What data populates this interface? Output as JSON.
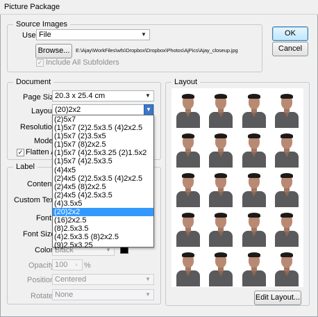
{
  "window": {
    "title": "Picture Package"
  },
  "source": {
    "legend": "Source Images",
    "use_label": "Use:",
    "use_value": "File",
    "browse_label": "Browse...",
    "file_path": "E:\\Ajay\\WorkFiles\\wfs\\Dropbox\\Dropbox\\Photos\\AjPics\\Ajay_closeup.jpg",
    "include_subfolders": "Include All Subfolders"
  },
  "buttons": {
    "ok": "OK",
    "cancel": "Cancel",
    "edit_layout": "Edit Layout..."
  },
  "document": {
    "legend": "Document",
    "page_size_label": "Page Size:",
    "page_size_value": "20.3 x 25.4 cm",
    "layout_label": "Layout:",
    "layout_value": "(20)2x2",
    "resolution_label": "Resolution:",
    "mode_label": "Mode:",
    "flatten_label": "Flatten All"
  },
  "layout_options": [
    "(2)5x7",
    "(1)5x7 (2)2.5x3.5 (4)2x2.5",
    "(1)5x7 (2)3.5x5",
    "(1)5x7 (8)2x2.5",
    "(1)5x7 (4)2.5x3.25 (2)1.5x2",
    "(1)5x7 (4)2.5x3.5",
    "(4)4x5",
    "(2)4x5 (2)2.5x3.5 (4)2x2.5",
    "(2)4x5 (8)2x2.5",
    "(2)4x5 (4)2.5x3.5",
    "(4)3.5x5",
    "(20)2x2",
    "(16)2x2.5",
    "(8)2.5x3.5",
    "(4)2.5x3.5 (8)2x2.5",
    "(9)2.5x3.25"
  ],
  "label": {
    "legend": "Label",
    "content_label": "Content:",
    "custom_text_label": "Custom Text:",
    "font_label": "Font:",
    "font_size_label": "Font Size:",
    "color_label": "Color:",
    "color_value": "Black",
    "opacity_label": "Opacity:",
    "opacity_value": "100",
    "opacity_unit": "%",
    "position_label": "Position:",
    "position_value": "Centered",
    "rotate_label": "Rotate:",
    "rotate_value": "None"
  },
  "preview": {
    "legend": "Layout",
    "rows": 5,
    "cols": 4
  }
}
